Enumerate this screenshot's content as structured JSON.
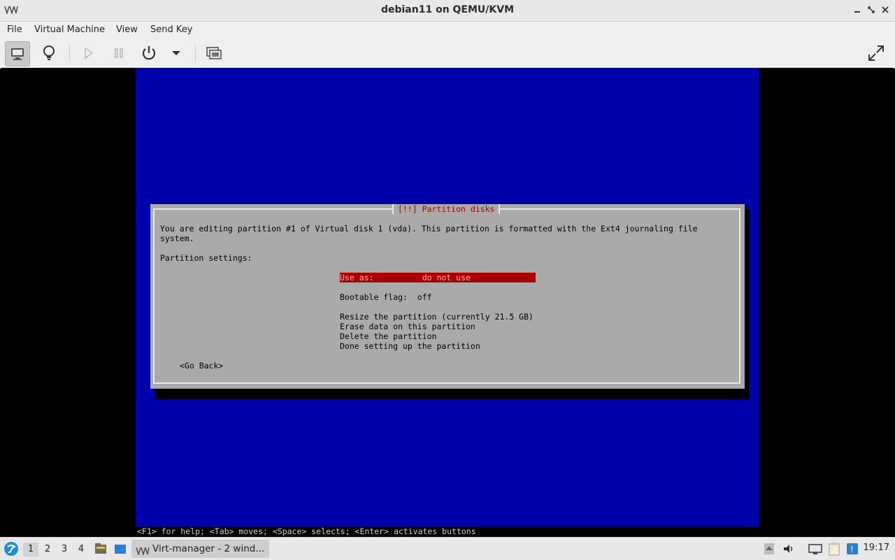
{
  "window": {
    "title": "debian11 on QEMU/KVM",
    "app_icon": "VM"
  },
  "menu": [
    "File",
    "Virtual Machine",
    "View",
    "Send Key"
  ],
  "toolbar": {
    "items": [
      "console-view-icon",
      "lightbulb-details-icon",
      "run-icon",
      "pause-icon",
      "power-icon",
      "dropdown-icon",
      "snapshots-icon",
      "fullscreen-icon"
    ]
  },
  "installer": {
    "dialog_title": "[!!] Partition disks",
    "intro_line1": "You are editing partition #1 of Virtual disk 1 (vda). This partition is formatted with the Ext4 journaling file",
    "intro_line2": "system.",
    "settings_label": "Partition settings:",
    "use_as": "Use as:          do not use",
    "bootable": "Bootable flag:  off",
    "resize": "Resize the partition (currently 21.5 GB)",
    "erase": "Erase data on this partition",
    "delete": "Delete the partition",
    "done": "Done setting up the partition",
    "go_back": "<Go Back>",
    "help_line": "<F1> for help; <Tab> moves; <Space> selects; <Enter> activates buttons"
  },
  "taskbar": {
    "workspaces": [
      "1",
      "2",
      "3",
      "4"
    ],
    "current_workspace": "1",
    "task_label": "Virt-manager - 2 wind...",
    "clock": "19:17"
  },
  "colors": {
    "installer_bg": "#0000aa",
    "dialog_bg": "#aaaaaa",
    "highlight": "#aa0000"
  }
}
